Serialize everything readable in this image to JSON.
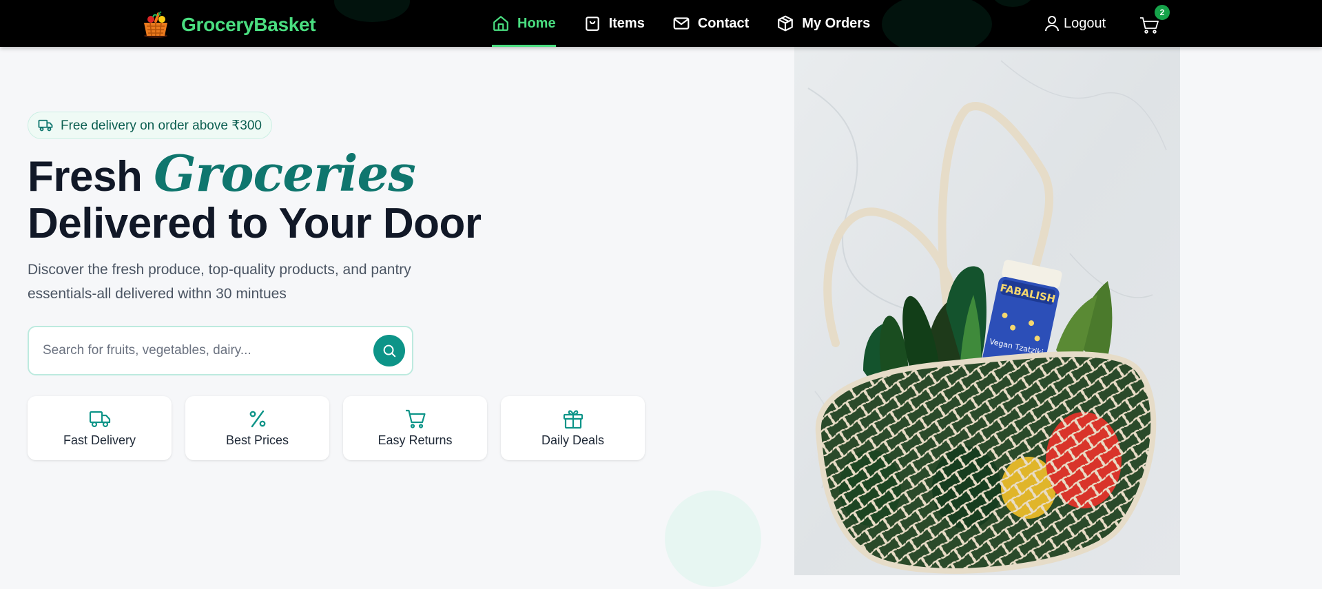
{
  "brand": {
    "name": "GroceryBasket",
    "logo_icon": "basket-icon",
    "color": "#4ade80"
  },
  "nav": {
    "items": [
      {
        "label": "Home",
        "icon": "home-icon",
        "active": true
      },
      {
        "label": "Items",
        "icon": "shopping-bag-icon",
        "active": false
      },
      {
        "label": "Contact",
        "icon": "mail-icon",
        "active": false
      },
      {
        "label": "My Orders",
        "icon": "package-icon",
        "active": false
      }
    ],
    "logout_label": "Logout",
    "cart_count": "2"
  },
  "hero": {
    "badge_text": "Free delivery on order above ₹300",
    "headline_word1": "Fresh",
    "headline_accent": "Groceries",
    "headline_line2": "Delivered to Your Door",
    "subtext": "Discover the fresh produce, top-quality products, and pantry essentials-all delivered withn 30 mintues",
    "search_placeholder": "Search for fruits, vegetables, dairy..."
  },
  "features": [
    {
      "label": "Fast Delivery",
      "icon": "truck-icon"
    },
    {
      "label": "Best Prices",
      "icon": "percent-icon"
    },
    {
      "label": "Easy Returns",
      "icon": "cart-icon"
    },
    {
      "label": "Daily Deals",
      "icon": "gift-icon"
    }
  ],
  "colors": {
    "accent": "#0d9488",
    "accent_dark": "#0f766e",
    "nav_bg": "#000000",
    "nav_active": "#4ade80",
    "page_bg": "#f6f7f9"
  }
}
